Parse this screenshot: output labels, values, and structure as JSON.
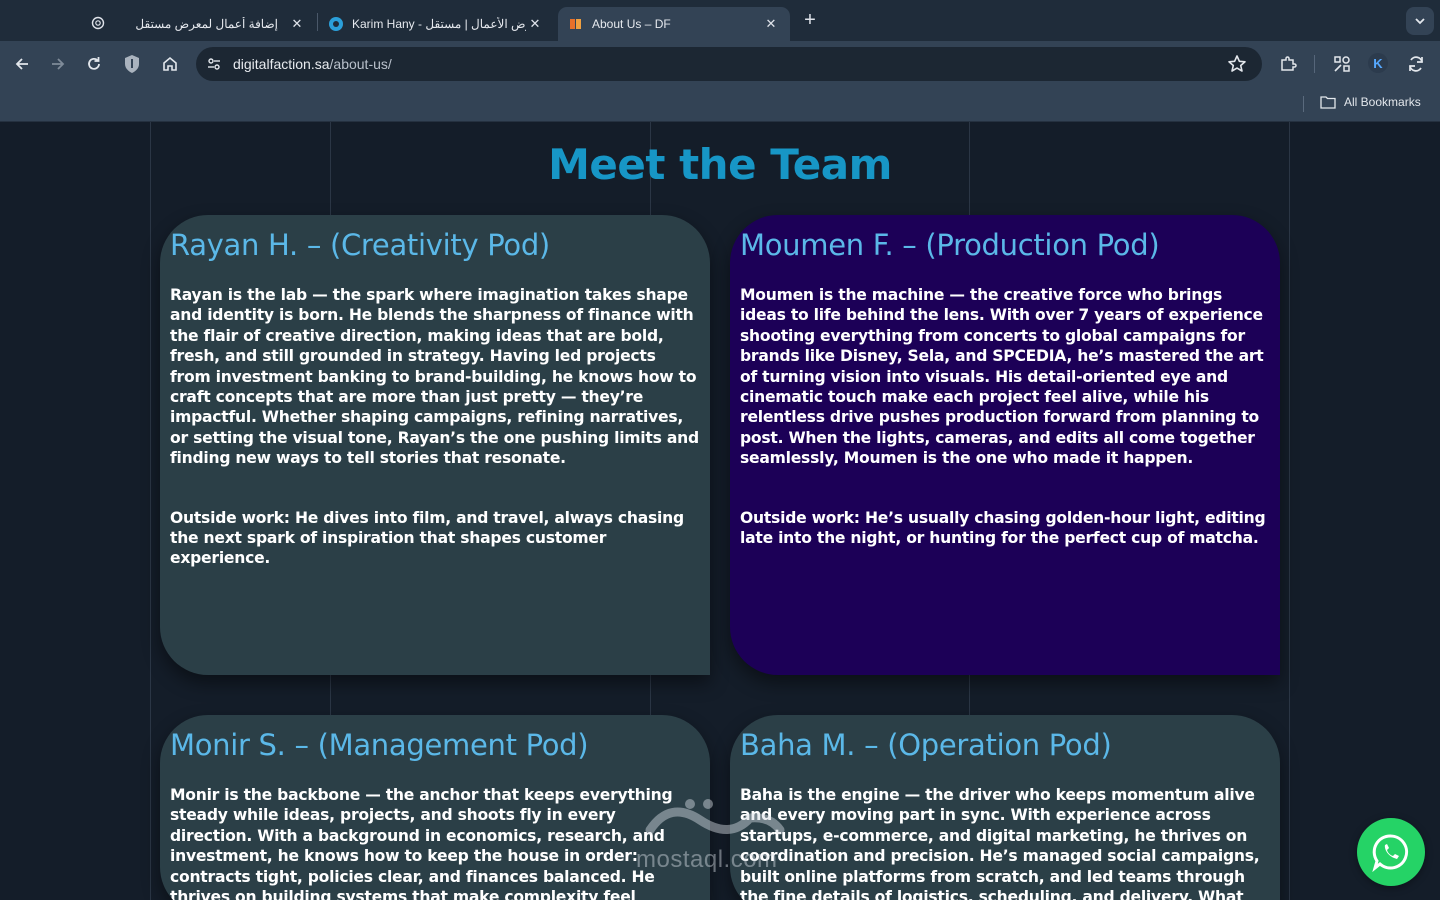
{
  "browser": {
    "tabs": [
      {
        "title": "إضافة أعمال لمعرض مستقل",
        "active": false
      },
      {
        "title": "Karim Hany - معرض الأعمال | مستقل",
        "active": false
      },
      {
        "title": "About Us – DF",
        "active": true
      }
    ],
    "url": {
      "host": "digitalfaction.sa",
      "path": "/about-us/"
    },
    "profile_initial": "K",
    "bookmarks_label": "All Bookmarks"
  },
  "page": {
    "heading": "Meet the Team",
    "members": [
      {
        "name": "Rayan H. – (Creativity Pod)",
        "bio": "Rayan is the lab — the spark where imagination takes shape and identity is born. He blends the sharpness of finance with the flair of creative direction, making ideas that are bold, fresh, and still grounded in strategy. Having led projects from investment banking to brand-building, he knows how to craft concepts that are more than just pretty — they’re impactful. Whether shaping campaigns, refining narratives, or setting the visual tone, Rayan’s the one pushing limits and finding new ways to tell stories that resonate.",
        "outside": "Outside work: He dives into film, and travel, always chasing the next spark of inspiration that shapes customer experience."
      },
      {
        "name": "Moumen F. – (Production Pod)",
        "bio": "Moumen is the machine — the creative force who brings ideas to life behind the lens. With over 7 years of experience shooting everything from concerts to global campaigns for brands like Disney, Sela, and SPCEDIA, he’s mastered the art of turning vision into visuals. His detail-oriented eye and cinematic touch make each project feel alive, while his relentless drive pushes production forward from planning to post. When the lights, cameras, and edits all come together seamlessly, Moumen is the one who made it happen.",
        "outside": "Outside work: He’s usually chasing golden-hour light, editing late into the night, or hunting for the perfect cup of matcha."
      },
      {
        "name": "Monir S. – (Management Pod)",
        "bio": "Monir is the backbone — the anchor that keeps everything steady while ideas, projects, and shoots fly in every direction. With a background in economics, research, and investment, he knows how to keep the house in order: contracts tight, policies clear, and finances balanced. He thrives on building systems that make complexity feel simple, making sure the"
      },
      {
        "name": "Baha M. – (Operation Pod)",
        "bio": "Baha is the engine — the driver who keeps momentum alive and every moving part in sync. With experience across startups, e-commerce, and digital marketing, he thrives on coordination and precision. He’s managed social campaigns, built online platforms from scratch, and led teams through the fine details of logistics, scheduling, and delivery. What"
      }
    ],
    "watermark": "mostaql.com",
    "colors": {
      "heading": "#1796c6",
      "card_teal": "#2b3f47",
      "card_purple": "#1c0057",
      "name": "#5bb8e8",
      "whatsapp": "#25d366"
    }
  }
}
